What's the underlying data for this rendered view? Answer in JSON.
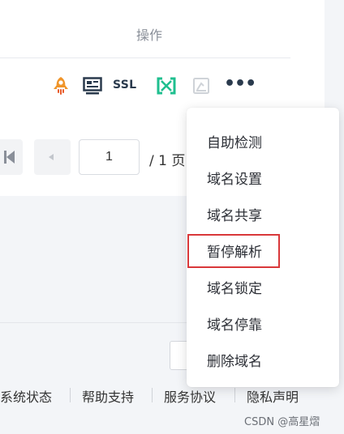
{
  "table": {
    "ops_header": "操作",
    "action_icons": [
      "rocket-icon",
      "monitor-icon",
      "ssl-icon",
      "bracket-icon",
      "document-icon",
      "more-icon"
    ],
    "ssl_label": "SSL",
    "more_label": "•••"
  },
  "pagination": {
    "current_page": "1",
    "total_label": "/ 1 页"
  },
  "dropdown": {
    "items": [
      {
        "label": "自助检测"
      },
      {
        "label": "域名设置"
      },
      {
        "label": "域名共享"
      },
      {
        "label": "暂停解析",
        "highlighted": true
      },
      {
        "label": "域名锁定"
      },
      {
        "label": "域名停靠"
      },
      {
        "label": "删除域名"
      }
    ]
  },
  "footer": {
    "links": [
      "系统状态",
      "帮助支持",
      "服务协议",
      "隐私声明"
    ]
  },
  "watermark": "CSDN @高星熠",
  "colors": {
    "rocket": "#f0952a",
    "bracket": "#1fbf8f",
    "dark_icon": "#2a3a4d",
    "highlight_border": "#d9383a"
  }
}
